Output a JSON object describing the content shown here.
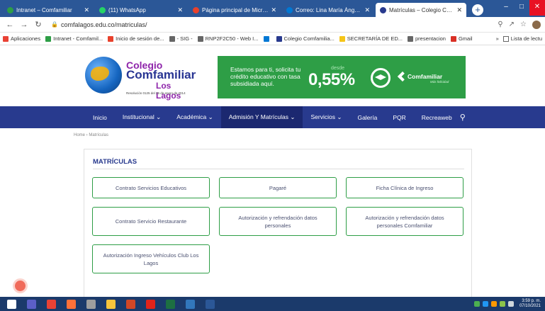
{
  "browser": {
    "tabs": [
      {
        "label": "Intranet – Comfamiliar",
        "color": "#2e9e46",
        "active": false
      },
      {
        "label": "(11) WhatsApp",
        "color": "#25d366",
        "active": false
      },
      {
        "label": "Página principal de Microsoft C",
        "color": "#e8412c",
        "active": false
      },
      {
        "label": "Correo: Lina María Ángel Gómez",
        "color": "#0078d4",
        "active": false
      },
      {
        "label": "Matrículas – Colegio Comfamilia",
        "color": "#283a8e",
        "active": true
      }
    ],
    "new_tab_label": "+",
    "url": "comfalagos.edu.co/matriculas/",
    "bookmarks": [
      {
        "label": "Aplicaciones",
        "color": "#e94235"
      },
      {
        "label": "Intranet - Comfamil...",
        "color": "#2e9e46"
      },
      {
        "label": "Inicio de sesión de...",
        "color": "#e8412c"
      },
      {
        "label": "- SIG -",
        "color": "#666666"
      },
      {
        "label": "RNP2F2C50 - Web I...",
        "color": "#666666"
      },
      {
        "label": "",
        "color": "#0078d4"
      },
      {
        "label": "Colegio Comfamilia...",
        "color": "#283a8e"
      },
      {
        "label": "SECRETARÍA DE ED...",
        "color": "#f5c518"
      },
      {
        "label": "presentacion",
        "color": "#666666"
      },
      {
        "label": "Gmail",
        "color": "#d93025"
      }
    ],
    "bookmarks_overflow": "»",
    "reading_list": "Lista de lectu"
  },
  "site": {
    "logo": {
      "line1": "Colegio",
      "line2": "Comfamiliar",
      "line3": "Los Lagos",
      "resolution": "Resolución 0125 del 25 de enero de 2014"
    },
    "banner": {
      "text": "Estamos para ti, solicita tu crédito educativo con tasa subsidiada aquí.",
      "desde": "desde",
      "percent": "0,55%",
      "brand": "Comfamiliar",
      "brand_sub": "Más felicidad"
    },
    "nav": [
      {
        "label": "Inicio",
        "active": false
      },
      {
        "label": "Institucional ⌄",
        "active": false
      },
      {
        "label": "Académica ⌄",
        "active": false
      },
      {
        "label": "Admisión Y Matrículas ⌄",
        "active": true
      },
      {
        "label": "Servicios ⌄",
        "active": false
      },
      {
        "label": "Galería",
        "active": false
      },
      {
        "label": "PQR",
        "active": false
      },
      {
        "label": "Recreaweb",
        "active": false
      }
    ],
    "breadcrumb": "Home  ›  Matrículas",
    "section_title": "MATRÍCULAS",
    "buttons": [
      "Contrato Servicios Educativos",
      "Pagaré",
      "Ficha Clínica de Ingreso",
      "Contrato Servicio Restaurante",
      "Autorización y refrendación datos personales",
      "Autorización y refrendación datos personales Comfamiliar",
      "Autorización Ingreso Vehículos Club Los Lagos"
    ]
  },
  "taskbar": {
    "apps": [
      {
        "name": "windows",
        "color": "#ffffff"
      },
      {
        "name": "teams",
        "color": "#5b5fc7"
      },
      {
        "name": "chrome",
        "color": "#e94235"
      },
      {
        "name": "firefox",
        "color": "#ff7139"
      },
      {
        "name": "gimp",
        "color": "#9e9e9e"
      },
      {
        "name": "file-explorer",
        "color": "#f8c43c"
      },
      {
        "name": "powerpoint",
        "color": "#d24726"
      },
      {
        "name": "acrobat",
        "color": "#e2231a"
      },
      {
        "name": "excel",
        "color": "#1d6f42"
      },
      {
        "name": "edge",
        "color": "#3277bc"
      },
      {
        "name": "word",
        "color": "#2b5797"
      }
    ],
    "time": "3:59 p. m.",
    "date": "07/10/2021"
  }
}
